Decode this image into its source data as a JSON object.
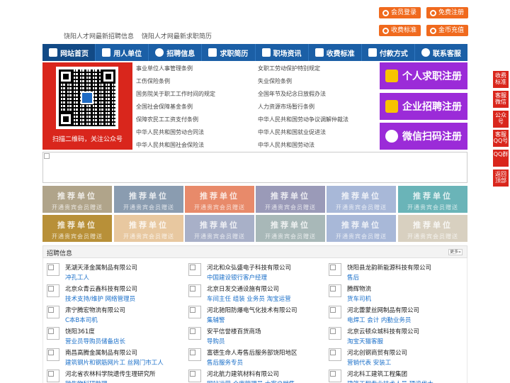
{
  "header": {
    "links": [
      "饶阳人才网最新招聘信息",
      "饶阳人才网最新求职简历"
    ],
    "buttons": [
      {
        "label": "会员登录",
        "icon": "user-icon"
      },
      {
        "label": "免费注册",
        "icon": "register-icon"
      },
      {
        "label": "收费标准",
        "icon": "price-icon"
      },
      {
        "label": "金币充值",
        "icon": "coin-icon"
      }
    ]
  },
  "nav": {
    "items": [
      {
        "label": "网站首页",
        "icon": "home-icon"
      },
      {
        "label": "用人单位",
        "icon": "building-icon"
      },
      {
        "label": "招聘信息",
        "icon": "recruit-icon"
      },
      {
        "label": "求职简历",
        "icon": "resume-icon"
      },
      {
        "label": "职场资讯",
        "icon": "news-icon"
      },
      {
        "label": "收费标准",
        "icon": "price-icon"
      },
      {
        "label": "付款方式",
        "icon": "payment-icon"
      },
      {
        "label": "联系客服",
        "icon": "service-icon"
      }
    ]
  },
  "banner": {
    "qr_caption": "扫描二维码，关注公众号",
    "laws_left": [
      "事业单位人事管理条例",
      "工伤保险条例",
      "国务院关于职工工作时间的规定",
      "全国社会保障基金条例",
      "保障农民工工资支付条例",
      "中华人民共和国劳动合同法",
      "中华人民共和国社会保险法"
    ],
    "laws_right": [
      "女职工劳动保护特别规定",
      "失业保险条例",
      "全国年节及纪念日放假办法",
      "人力资源市场暂行条例",
      "中华人民共和国劳动争议调解仲裁法",
      "中华人民共和国就业促进法",
      "中华人民共和国劳动法"
    ],
    "register": [
      {
        "label": "个人求职注册",
        "icon": "person-icon"
      },
      {
        "label": "企业招聘注册",
        "icon": "company-icon"
      },
      {
        "label": "微信扫码注册",
        "icon": "wechat-icon"
      }
    ]
  },
  "recommend": {
    "title": "推荐单位",
    "subtitle": "开通贵宾会员赠送",
    "colors": [
      "#b0a48a",
      "#8a9cb0",
      "#e88a6a",
      "#9a9ab8",
      "#a8b8d8",
      "#6ab4b8",
      "#b89038",
      "#e8c8a0",
      "#a8b0c8",
      "#a8b8b8",
      "#a8b8d8",
      "#d8d0c0"
    ]
  },
  "jobs": {
    "title": "招聘信息",
    "more": "更多»",
    "columns": [
      [
        {
          "company": "芜湖天泽金属制品有限公司",
          "positions": "冲孔工人"
        },
        {
          "company": "北京众青云鑫科技有限公司",
          "positions": "技术支持/维护 网络管理员"
        },
        {
          "company": "肃宁腾宏物流有限公司",
          "positions": "C本B本司机"
        },
        {
          "company": "饶阳361度",
          "positions": "营业员导购员储备店长"
        },
        {
          "company": "南昌高腾金属制品有限公司",
          "positions": "建筑钢片和钢筋网片工 丝网门市工人"
        },
        {
          "company": "河北省农林科学院遗传生理研究所",
          "positions": "微生物科研助理"
        }
      ],
      [
        {
          "company": "河北和众弘盛电子科技有限公司",
          "positions": "中国建设银行客户经理"
        },
        {
          "company": "北京日发交通设施有限公司",
          "positions": "车间主任 组装 业务员 淘宝运营"
        },
        {
          "company": "河北驰阳防爆电气化技术有限公司",
          "positions": "集辅警"
        },
        {
          "company": "安平信誉楼百货商场",
          "positions": "导购员"
        },
        {
          "company": "富德生命人寿售后服务部饶阳地区",
          "positions": "售后服务专员"
        },
        {
          "company": "河北航力建筑材料有限公司",
          "positions": "网站运营 仓库管理员 大客户销售"
        }
      ],
      [
        {
          "company": "饶阳县龙韵新能源科技有限公司",
          "positions": "售后"
        },
        {
          "company": "腾辉物流",
          "positions": "货车司机"
        },
        {
          "company": "河北蕾蒙丝网制品有限公司",
          "positions": "电焊工 会计 内勤业务员"
        },
        {
          "company": "北京云顿众城科技有限公司",
          "positions": "淘宝天猫客服"
        },
        {
          "company": "河北创钢商贸有限公司",
          "positions": "营销代表 安装工"
        },
        {
          "company": "河北科工建筑工程集团",
          "positions": "建筑工程专业技术人员 硬滚伐木"
        }
      ]
    ]
  },
  "side_float": [
    {
      "label": "收费标准"
    },
    {
      "label": "客服微信"
    },
    {
      "label": "公众号"
    },
    {
      "label": "客服QQ号"
    },
    {
      "label": "QQ群"
    },
    {
      "label": "返回顶部"
    }
  ]
}
